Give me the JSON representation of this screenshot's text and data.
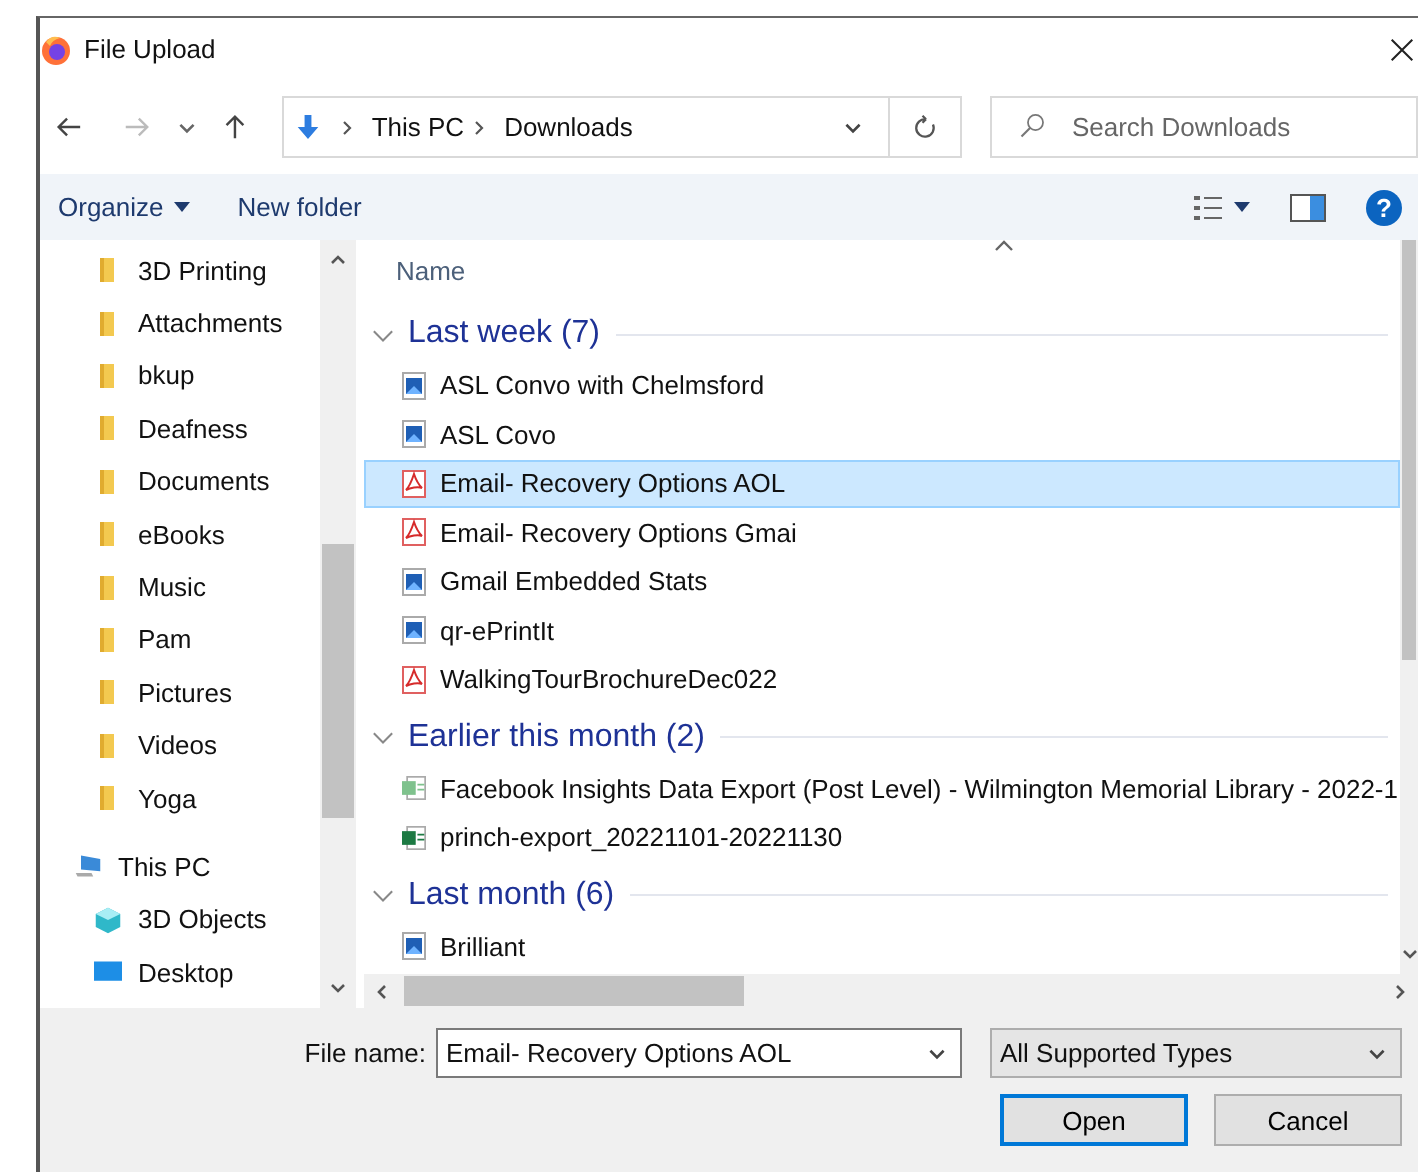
{
  "window": {
    "title": "File Upload"
  },
  "nav": {
    "path": [
      "This PC",
      "Downloads"
    ],
    "search": {
      "placeholder": "Search Downloads"
    }
  },
  "toolbar": {
    "organize": "Organize",
    "new_folder": "New folder",
    "help": "?"
  },
  "sidebar": {
    "items": [
      {
        "label": "3D Printing",
        "kind": "folder"
      },
      {
        "label": "Attachments",
        "kind": "folder"
      },
      {
        "label": "bkup",
        "kind": "folder"
      },
      {
        "label": "Deafness",
        "kind": "folder"
      },
      {
        "label": "Documents",
        "kind": "folder"
      },
      {
        "label": "eBooks",
        "kind": "folder"
      },
      {
        "label": "Music",
        "kind": "folder"
      },
      {
        "label": "Pam",
        "kind": "folder"
      },
      {
        "label": "Pictures",
        "kind": "folder"
      },
      {
        "label": "Videos",
        "kind": "folder"
      },
      {
        "label": "Yoga",
        "kind": "folder"
      },
      {
        "label": "This PC",
        "kind": "pc",
        "children": [
          {
            "label": "3D Objects",
            "kind": "objects3d"
          },
          {
            "label": "Desktop",
            "kind": "desktop"
          }
        ]
      }
    ]
  },
  "files": {
    "column": "Name",
    "groups": [
      {
        "label": "Last week (7)",
        "expanded": true,
        "items": [
          {
            "name": "ASL Convo with Chelmsford",
            "kind": "image",
            "selected": false
          },
          {
            "name": "ASL Covo",
            "kind": "image",
            "selected": false
          },
          {
            "name": "Email- Recovery Options AOL",
            "kind": "pdf",
            "selected": true
          },
          {
            "name": "Email- Recovery Options Gmai",
            "kind": "pdf",
            "selected": false
          },
          {
            "name": "Gmail Embedded Stats",
            "kind": "image",
            "selected": false
          },
          {
            "name": "qr-ePrintIt",
            "kind": "image",
            "selected": false
          },
          {
            "name": "WalkingTourBrochureDec022",
            "kind": "pdf",
            "selected": false
          }
        ]
      },
      {
        "label": "Earlier this month (2)",
        "expanded": true,
        "items": [
          {
            "name": "Facebook Insights Data Export (Post Level) - Wilmington Memorial Library - 2022-1",
            "kind": "csv",
            "selected": false
          },
          {
            "name": "princh-export_20221101-20221130",
            "kind": "excel",
            "selected": false
          }
        ]
      },
      {
        "label": "Last month (6)",
        "expanded": true,
        "items": [
          {
            "name": "Brilliant",
            "kind": "image",
            "selected": false
          }
        ]
      }
    ]
  },
  "bottom": {
    "file_name_label": "File name:",
    "file_name": "Email- Recovery Options AOL",
    "file_type": "All Supported Types",
    "buttons": [
      {
        "label": "Open",
        "default": true
      },
      {
        "label": "Cancel",
        "default": false
      }
    ]
  }
}
